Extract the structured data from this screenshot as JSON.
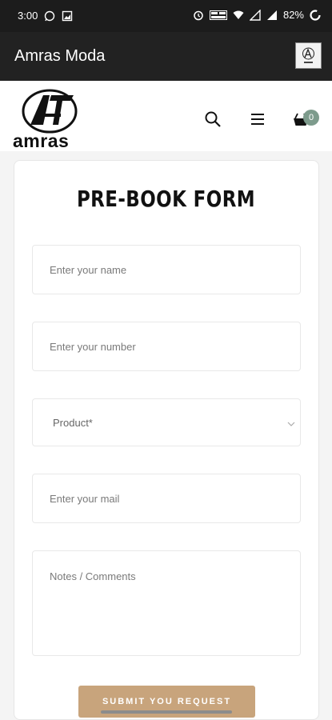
{
  "status_bar": {
    "time": "3:00",
    "battery": "82%",
    "icons": [
      "whatsapp-icon",
      "image-icon",
      "alarm-icon",
      "volte-icon",
      "wifi-icon",
      "signal-icon",
      "signal-icon",
      "battery-icon"
    ]
  },
  "app_bar": {
    "title": "Amras Moda"
  },
  "site_header": {
    "logo_text": "amras",
    "cart_count": "0",
    "icons": [
      "search-icon",
      "menu-icon",
      "cart-icon"
    ]
  },
  "form": {
    "title": "PRE-BOOK FORM",
    "name_placeholder": "Enter your name",
    "number_placeholder": "Enter your number",
    "product_select": "Product*",
    "mail_placeholder": "Enter your mail",
    "notes_placeholder": "Notes / Comments",
    "submit_label": "SUBMIT YOU REQUEST"
  },
  "colors": {
    "status_bar_bg": "#1c1c1c",
    "app_bar_bg": "#222222",
    "submit_bg": "#c8a47c",
    "cart_badge_bg": "#7d9b8c"
  }
}
